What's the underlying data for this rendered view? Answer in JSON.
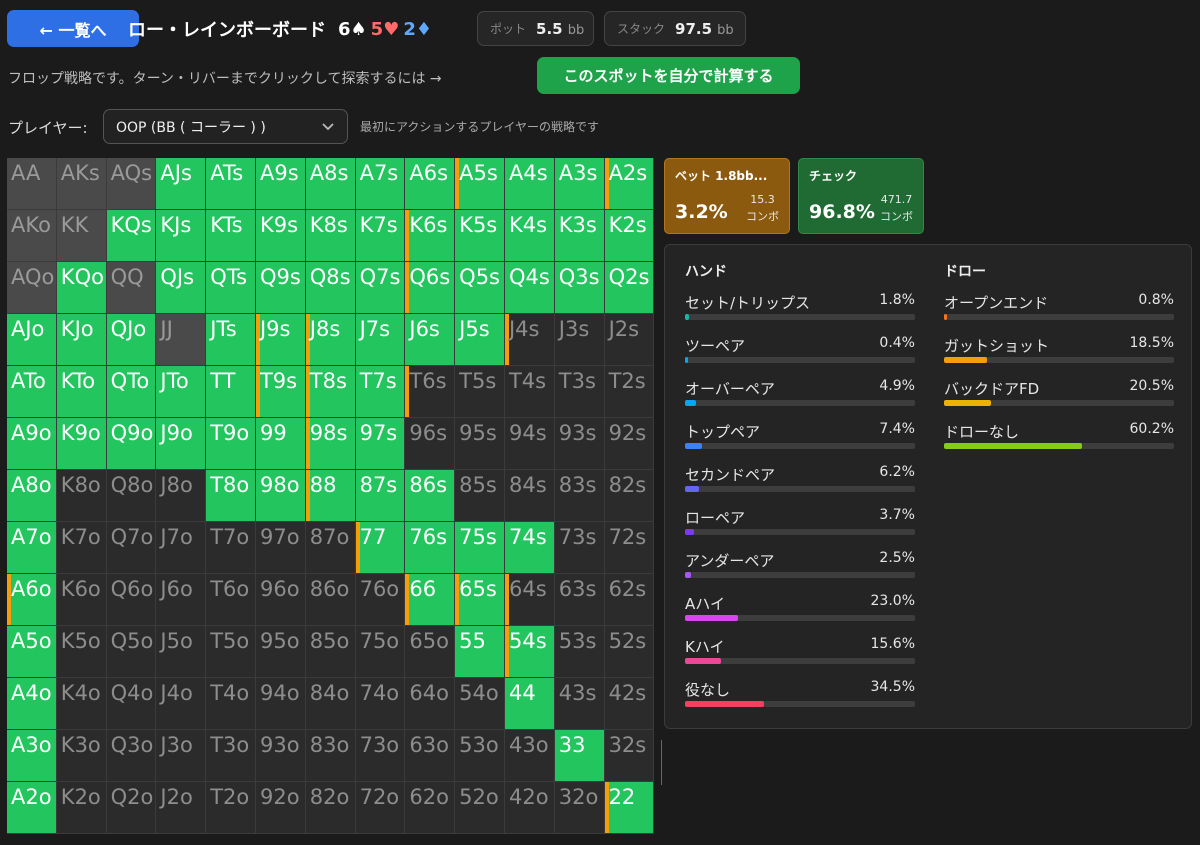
{
  "header": {
    "back_label": "← 一覧へ",
    "title": "ロー・レインボーボード",
    "board": [
      {
        "rank": "6",
        "suit": "♠"
      },
      {
        "rank": "5",
        "suit": "♥"
      },
      {
        "rank": "2",
        "suit": "♦"
      }
    ],
    "pot_label": "ポット",
    "pot_value": "5.5",
    "pot_unit": "bb",
    "stack_label": "スタック",
    "stack_value": "97.5",
    "stack_unit": "bb"
  },
  "subtitle": "フロップ戦略です。ターン・リバーまでクリックして探索するには →",
  "calc_button": "このスポットを自分で計算する",
  "player": {
    "label": "プレイヤー:",
    "selected": "OOP (BB ( コーラー ) )",
    "note": "最初にアクションするプレイヤーの戦略です"
  },
  "grid": [
    [
      "AA",
      "AKs",
      "AQs",
      "AJs",
      "ATs",
      "A9s",
      "A8s",
      "A7s",
      "A6s",
      "A5s",
      "A4s",
      "A3s",
      "A2s"
    ],
    [
      "AKo",
      "KK",
      "KQs",
      "KJs",
      "KTs",
      "K9s",
      "K8s",
      "K7s",
      "K6s",
      "K5s",
      "K4s",
      "K3s",
      "K2s"
    ],
    [
      "AQo",
      "KQo",
      "QQ",
      "QJs",
      "QTs",
      "Q9s",
      "Q8s",
      "Q7s",
      "Q6s",
      "Q5s",
      "Q4s",
      "Q3s",
      "Q2s"
    ],
    [
      "AJo",
      "KJo",
      "QJo",
      "JJ",
      "JTs",
      "J9s",
      "J8s",
      "J7s",
      "J6s",
      "J5s",
      "J4s",
      "J3s",
      "J2s"
    ],
    [
      "ATo",
      "KTo",
      "QTo",
      "JTo",
      "TT",
      "T9s",
      "T8s",
      "T7s",
      "T6s",
      "T5s",
      "T4s",
      "T3s",
      "T2s"
    ],
    [
      "A9o",
      "K9o",
      "Q9o",
      "J9o",
      "T9o",
      "99",
      "98s",
      "97s",
      "96s",
      "95s",
      "94s",
      "93s",
      "92s"
    ],
    [
      "A8o",
      "K8o",
      "Q8o",
      "J8o",
      "T8o",
      "98o",
      "88",
      "87s",
      "86s",
      "85s",
      "84s",
      "83s",
      "82s"
    ],
    [
      "A7o",
      "K7o",
      "Q7o",
      "J7o",
      "T7o",
      "97o",
      "87o",
      "77",
      "76s",
      "75s",
      "74s",
      "73s",
      "72s"
    ],
    [
      "A6o",
      "K6o",
      "Q6o",
      "J6o",
      "T6o",
      "96o",
      "86o",
      "76o",
      "66",
      "65s",
      "64s",
      "63s",
      "62s"
    ],
    [
      "A5o",
      "K5o",
      "Q5o",
      "J5o",
      "T5o",
      "95o",
      "85o",
      "75o",
      "65o",
      "55",
      "54s",
      "53s",
      "52s"
    ],
    [
      "A4o",
      "K4o",
      "Q4o",
      "J4o",
      "T4o",
      "94o",
      "84o",
      "74o",
      "64o",
      "54o",
      "44",
      "43s",
      "42s"
    ],
    [
      "A3o",
      "K3o",
      "Q3o",
      "J3o",
      "T3o",
      "93o",
      "83o",
      "73o",
      "63o",
      "53o",
      "43o",
      "33",
      "32s"
    ],
    [
      "A2o",
      "K2o",
      "Q2o",
      "J2o",
      "T2o",
      "92o",
      "82o",
      "72o",
      "62o",
      "52o",
      "42o",
      "32o",
      "22"
    ]
  ],
  "grid_state": [
    "dddggggggggggg",
    "ddggggggggggg",
    "dgdgggggggggg",
    "gggdggggggeee",
    "ggggggggeeeee",
    "ggggggggeeeee",
    "geeegggggeeee",
    "geeeeeeggggee",
    "geeeeeeeggeeee",
    "geeeeeeeeggee",
    "geeeeeeeeegee",
    "geeeeeeeeeege",
    "geeeeeeeeeeeg"
  ],
  "bet_hands": [
    "A5s",
    "A2s",
    "K6s",
    "Q6s",
    "J9s",
    "J8s",
    "J4s",
    "T9s",
    "T8s",
    "T6s",
    "98s",
    "88",
    "77",
    "A6o",
    "66",
    "65s",
    "64s",
    "54s",
    "22"
  ],
  "actions": {
    "bet": {
      "label": "ベット 1.8bb...",
      "pct": "3.2%",
      "combos": "15.3",
      "combos_unit": "コンボ"
    },
    "check": {
      "label": "チェック",
      "pct": "96.8%",
      "combos": "471.7",
      "combos_unit": "コンボ"
    }
  },
  "colors": {
    "green": "#22c55e",
    "bet_orange": "#f59e0b"
  },
  "hands_panel": {
    "title": "ハンド",
    "items": [
      {
        "label": "セット/トリップス",
        "pct": "1.8%",
        "value": 1.8,
        "color": "#14b8a6"
      },
      {
        "label": "ツーペア",
        "pct": "0.4%",
        "value": 0.4,
        "color": "#0ea5e9"
      },
      {
        "label": "オーバーペア",
        "pct": "4.9%",
        "value": 4.9,
        "color": "#0ea5e9"
      },
      {
        "label": "トップペア",
        "pct": "7.4%",
        "value": 7.4,
        "color": "#3b82f6"
      },
      {
        "label": "セカンドペア",
        "pct": "6.2%",
        "value": 6.2,
        "color": "#6366f1"
      },
      {
        "label": "ローペア",
        "pct": "3.7%",
        "value": 3.7,
        "color": "#7c3aed"
      },
      {
        "label": "アンダーペア",
        "pct": "2.5%",
        "value": 2.5,
        "color": "#a855f7"
      },
      {
        "label": "Aハイ",
        "pct": "23.0%",
        "value": 23.0,
        "color": "#d946ef"
      },
      {
        "label": "Kハイ",
        "pct": "15.6%",
        "value": 15.6,
        "color": "#ec4899"
      },
      {
        "label": "役なし",
        "pct": "34.5%",
        "value": 34.5,
        "color": "#f43f5e"
      }
    ]
  },
  "draws_panel": {
    "title": "ドロー",
    "items": [
      {
        "label": "オープンエンド",
        "pct": "0.8%",
        "value": 0.8,
        "color": "#f97316"
      },
      {
        "label": "ガットショット",
        "pct": "18.5%",
        "value": 18.5,
        "color": "#f59e0b"
      },
      {
        "label": "バックドアFD",
        "pct": "20.5%",
        "value": 20.5,
        "color": "#eab308"
      },
      {
        "label": "ドローなし",
        "pct": "60.2%",
        "value": 60.2,
        "color": "#84cc16"
      }
    ]
  }
}
